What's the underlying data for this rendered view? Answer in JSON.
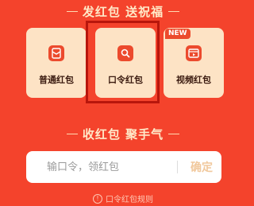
{
  "send_section": {
    "title": "发红包 送祝福"
  },
  "cards": [
    {
      "label": "普通红包",
      "icon": "red-envelope-icon"
    },
    {
      "label": "口令红包",
      "icon": "search-icon"
    },
    {
      "label": "视频红包",
      "icon": "video-icon",
      "badge": "NEW"
    }
  ],
  "receive_section": {
    "title": "收红包 聚手气",
    "input_placeholder": "输口令，领红包",
    "confirm_label": "确定"
  },
  "rules": {
    "icon": "info-icon",
    "label": "口令红包规则"
  },
  "colors": {
    "background": "#f4432c",
    "card": "#fde3c5",
    "accent": "#ec4a2d",
    "highlight_border": "#b8160c",
    "confirm_text": "#f1c89c"
  }
}
